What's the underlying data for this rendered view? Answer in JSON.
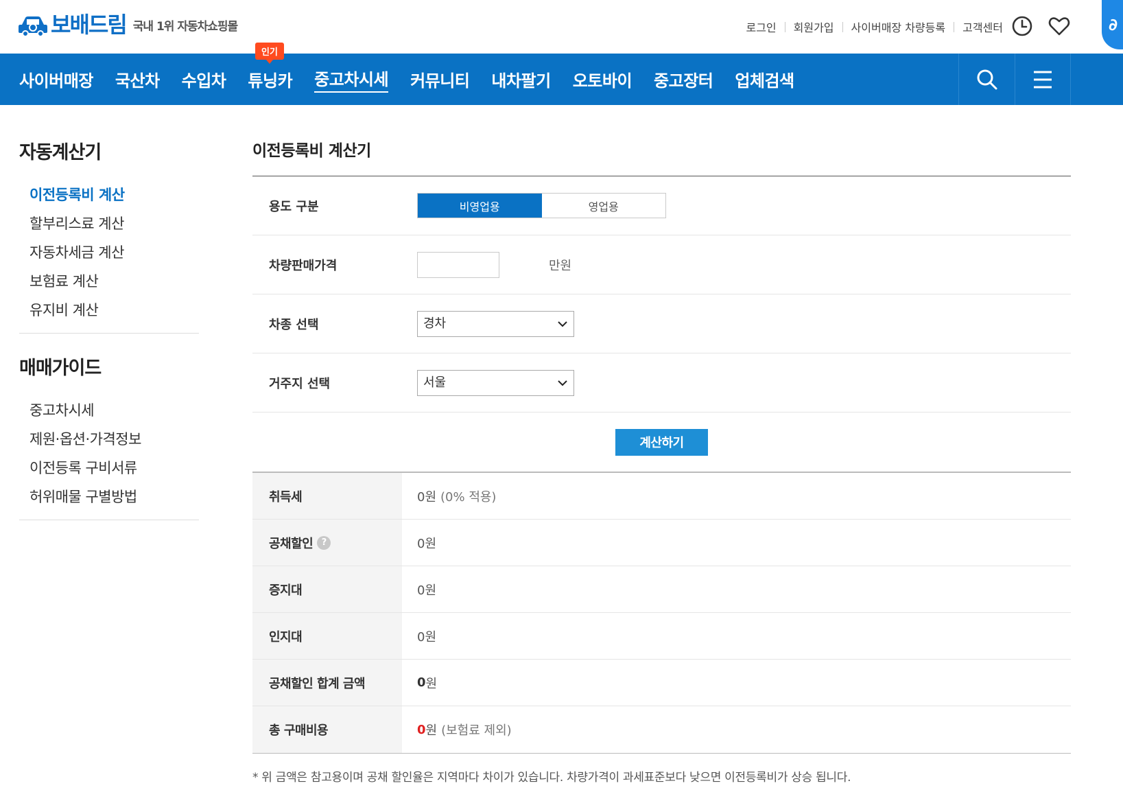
{
  "brand": {
    "name": "보배드림",
    "slogan": "국내 1위 자동차쇼핑몰",
    "color": "#0f6fc6"
  },
  "util_links": [
    "로그인",
    "회원가입",
    "사이버매장 차량등록",
    "고객센터"
  ],
  "nav": {
    "items": [
      "사이버매장",
      "국산차",
      "수입차",
      "튜닝카",
      "중고차시세",
      "커뮤니티",
      "내차팔기",
      "오토바이",
      "중고장터",
      "업체검색"
    ],
    "active": "중고차시세",
    "hot_badge": "인기",
    "color": "#0a72c4"
  },
  "sidebar": {
    "section1_title": "자동계산기",
    "section1_items": [
      "이전등록비 계산",
      "할부리스료 계산",
      "자동차세금 계산",
      "보험료 계산",
      "유지비 계산"
    ],
    "section2_title": "매매가이드",
    "section2_items": [
      "중고차시세",
      "제원·옵션·가격정보",
      "이전등록 구비서류",
      "허위매물 구별방법"
    ]
  },
  "main": {
    "title": "이전등록비 계산기",
    "usage_label": "용도 구분",
    "usage_options": [
      "비영업용",
      "영업용"
    ],
    "usage_selected": "비영업용",
    "price_label": "차량판매가격",
    "price_value": "",
    "price_unit": "만원",
    "type_label": "차종 선택",
    "type_value": "경차",
    "region_label": "거주지 선택",
    "region_value": "서울",
    "calc_button": "계산하기"
  },
  "results": {
    "acq_tax_label": "취득세",
    "acq_tax_value": "0원",
    "acq_tax_note": "(0% 적용)",
    "bond_discount_label": "공채할인",
    "bond_discount_value": "0원",
    "stamp_label": "증지대",
    "stamp_value": "0원",
    "revenue_stamp_label": "인지대",
    "revenue_stamp_value": "0원",
    "bond_total_label": "공채할인 합계 금액",
    "bond_total_amount": "0",
    "bond_total_unit": "원",
    "grand_total_label": "총 구매비용",
    "grand_total_amount": "0",
    "grand_total_unit": "원",
    "grand_total_note": "(보험료 제외)"
  },
  "footnote": "* 위 금액은 참고용이며 공채 할인율은 지역마다 차이가 있습니다. 차량가격이 과세표준보다 낮으면 이전등록비가 상승 됩니다."
}
